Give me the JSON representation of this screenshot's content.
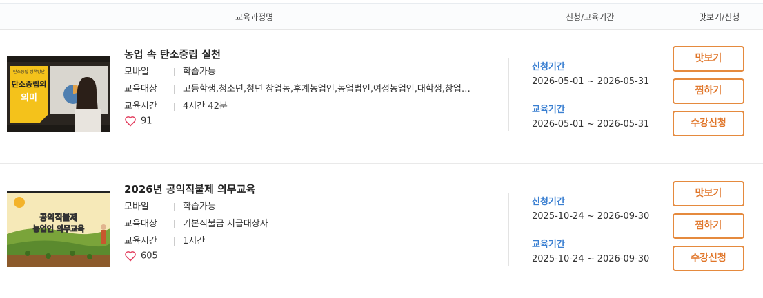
{
  "header": {
    "name_col": "교육과정명",
    "period_col": "신청/교육기간",
    "action_col": "맛보기/신청"
  },
  "courses": [
    {
      "title": "농업 속 탄소중립 실천",
      "thumb_text": [
        "탄소중립 정책방안",
        "탄소중립의",
        "의미"
      ],
      "device_label": "모바일",
      "device_value": "학습가능",
      "target_label": "교육대상",
      "target_value": "고등학생,청소년,청년 창업농,후계농업인,농업법인,여성농업인,대학생,창업…",
      "time_label": "교육시간",
      "time_value": "4시간 42분",
      "likes": "91",
      "apply_label": "신청기간",
      "apply_period": "2026-05-01 ~ 2026-05-31",
      "edu_label": "교육기간",
      "edu_period": "2026-05-01 ~ 2026-05-31",
      "btn_preview": "맛보기",
      "btn_wish": "찜하기",
      "btn_enroll": "수강신청"
    },
    {
      "title": "2026년 공익직불제 의무교육",
      "thumb_text": [
        "공익직불제",
        "농업인 의무교육"
      ],
      "device_label": "모바일",
      "device_value": "학습가능",
      "target_label": "교육대상",
      "target_value": "기본직불금 지급대상자",
      "time_label": "교육시간",
      "time_value": "1시간",
      "likes": "605",
      "apply_label": "신청기간",
      "apply_period": "2025-10-24 ~ 2026-09-30",
      "edu_label": "교육기간",
      "edu_period": "2025-10-24 ~ 2026-09-30",
      "btn_preview": "맛보기",
      "btn_wish": "찜하기",
      "btn_enroll": "수강신청"
    }
  ],
  "colors": {
    "accent_orange": "#e0762a",
    "period_blue": "#3a7fd1",
    "heart": "#e23a5b"
  }
}
